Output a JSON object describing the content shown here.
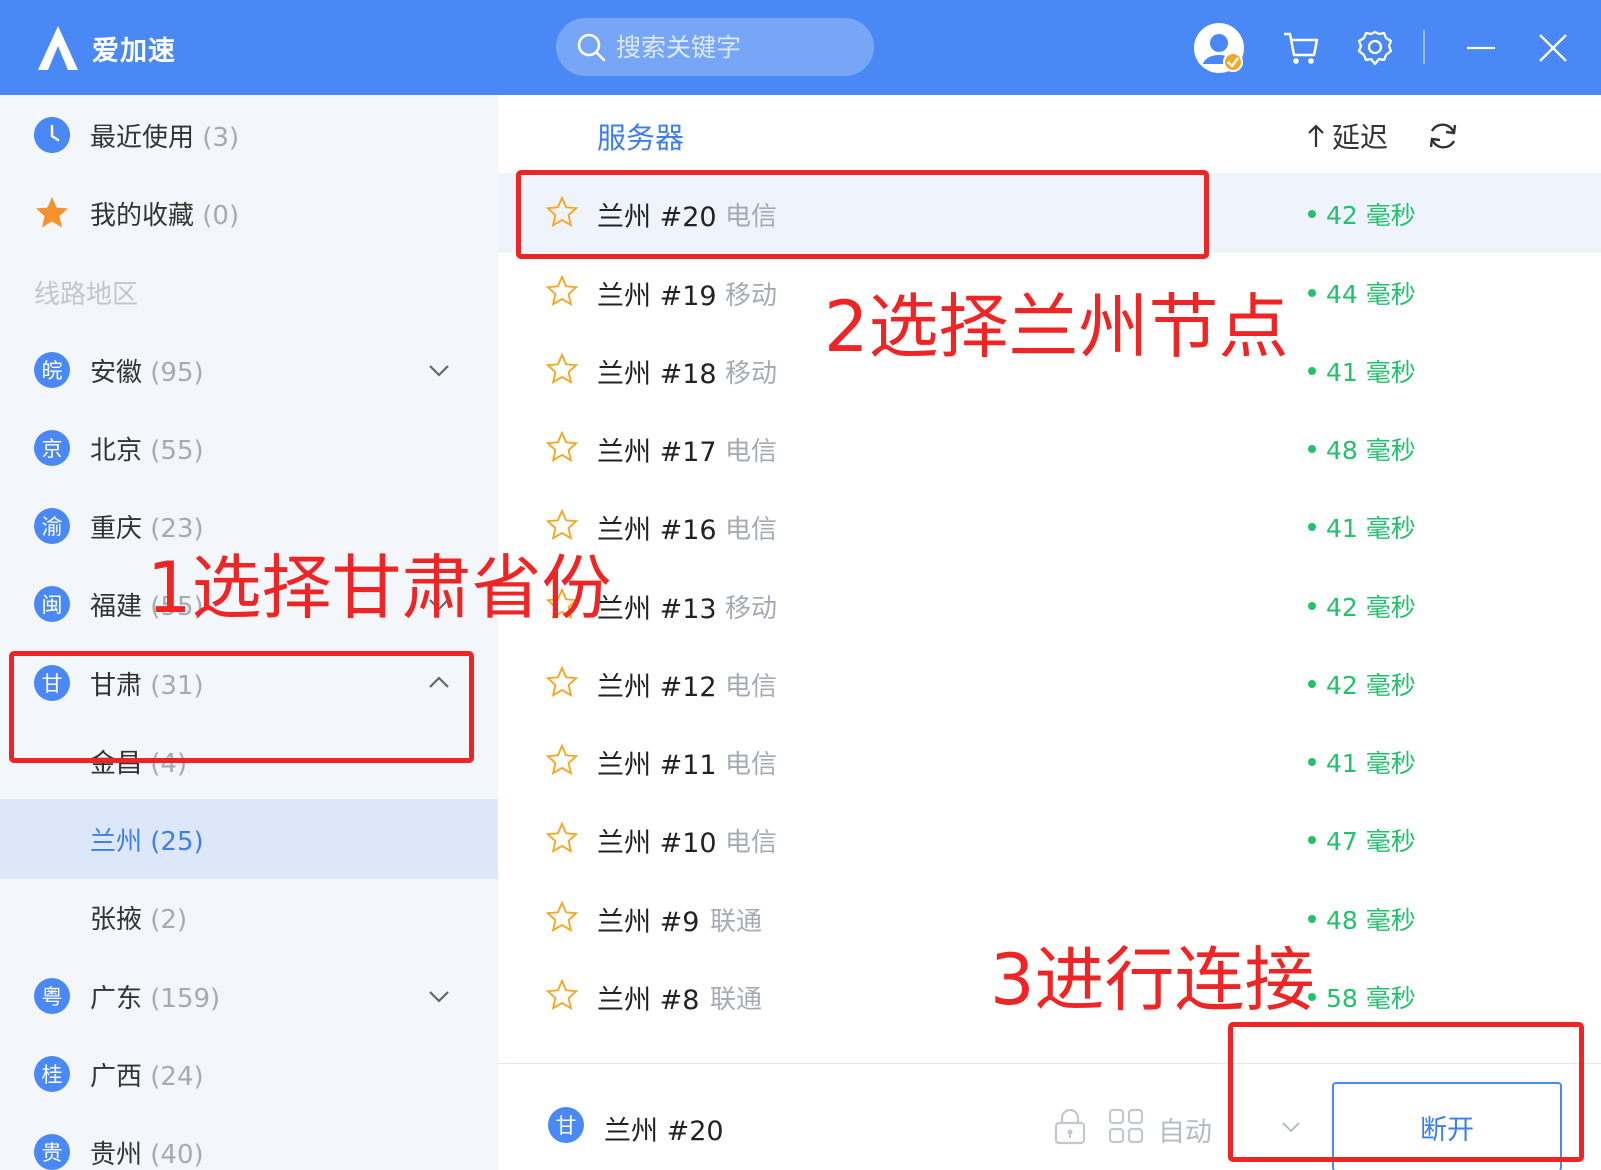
{
  "app": {
    "logo_text": "爱加速"
  },
  "search": {
    "placeholder": "搜索关键字"
  },
  "colors": {
    "brand": "#4a88f5",
    "latency_green": "#22c16b",
    "annotation_red": "#ef2424",
    "selected_bg": "#dce7f9"
  },
  "sidebar": {
    "recent": {
      "label": "最近使用",
      "count": "(3)"
    },
    "favorites": {
      "label": "我的收藏",
      "count": "(0)"
    },
    "section_title": "线路地区",
    "regions": [
      {
        "badge": "皖",
        "label": "安徽",
        "count": "(95)"
      },
      {
        "badge": "京",
        "label": "北京",
        "count": "(55)"
      },
      {
        "badge": "渝",
        "label": "重庆",
        "count": "(23)"
      },
      {
        "badge": "闽",
        "label": "福建",
        "count": "(55)"
      },
      {
        "badge": "甘",
        "label": "甘肃",
        "count": "(31)"
      },
      {
        "badge": "粤",
        "label": "广东",
        "count": "(159)"
      },
      {
        "badge": "桂",
        "label": "广西",
        "count": "(24)"
      },
      {
        "badge": "贵",
        "label": "贵州",
        "count": "(40)"
      }
    ],
    "subregions": [
      {
        "label": "金昌",
        "count": "(4)"
      },
      {
        "label": "兰州",
        "count": "(25)"
      },
      {
        "label": "张掖",
        "count": "(2)"
      }
    ]
  },
  "list": {
    "header_server": "服务器",
    "header_latency": "延迟",
    "rows": [
      {
        "name": "兰州 #20",
        "isp": "电信",
        "latency": "42 毫秒"
      },
      {
        "name": "兰州 #19",
        "isp": "移动",
        "latency": "44 毫秒"
      },
      {
        "name": "兰州 #18",
        "isp": "移动",
        "latency": "41 毫秒"
      },
      {
        "name": "兰州 #17",
        "isp": "电信",
        "latency": "48 毫秒"
      },
      {
        "name": "兰州 #16",
        "isp": "电信",
        "latency": "41 毫秒"
      },
      {
        "name": "兰州 #13",
        "isp": "移动",
        "latency": "42 毫秒"
      },
      {
        "name": "兰州 #12",
        "isp": "电信",
        "latency": "42 毫秒"
      },
      {
        "name": "兰州 #11",
        "isp": "电信",
        "latency": "41 毫秒"
      },
      {
        "name": "兰州 #10",
        "isp": "电信",
        "latency": "47 毫秒"
      },
      {
        "name": "兰州 #9",
        "isp": "联通",
        "latency": "48 毫秒"
      },
      {
        "name": "兰州 #8",
        "isp": "联通",
        "latency": "58 毫秒"
      }
    ]
  },
  "footer": {
    "badge": "甘",
    "current_server": "兰州 #20",
    "mode": "自动",
    "disconnect_label": "断开"
  },
  "annotations": {
    "step1": "1选择甘肃省份",
    "step2": "2选择兰州节点",
    "step3": "3进行连接"
  }
}
